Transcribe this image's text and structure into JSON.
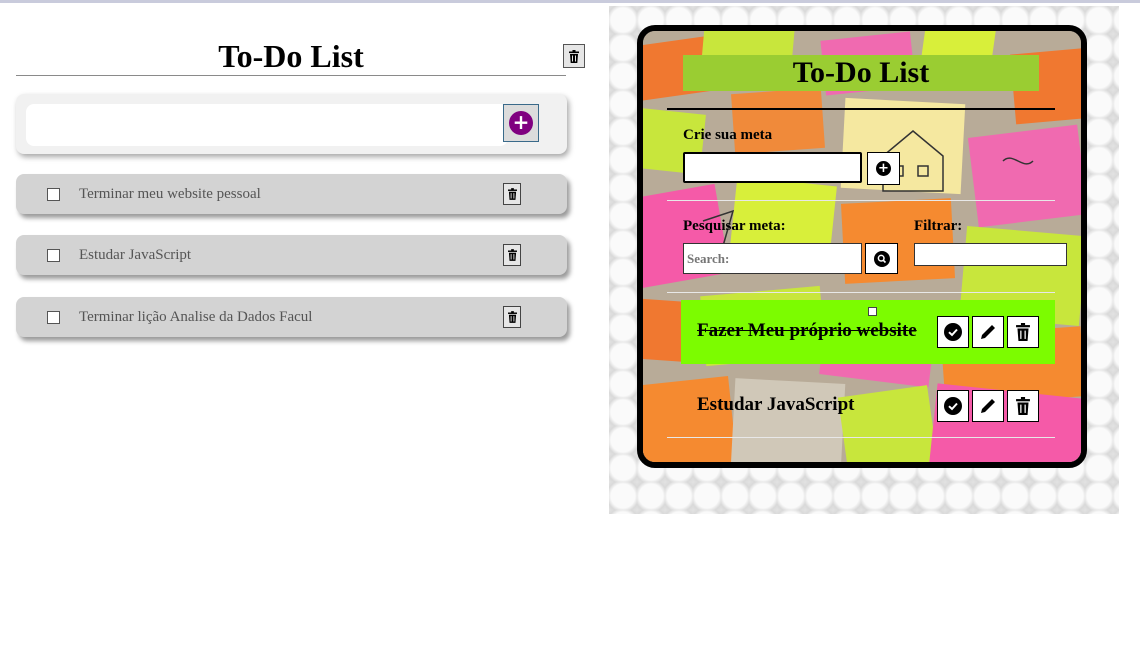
{
  "left_app": {
    "title": "To-Do List",
    "add_input": {
      "value": "",
      "placeholder": ""
    },
    "add_icon": "plus-circle-icon",
    "clear_icon": "trash-icon",
    "items": [
      {
        "text": "Terminar meu website pessoal",
        "checked": false
      },
      {
        "text": "Estudar JavaScript",
        "checked": false
      },
      {
        "text": "Terminar lição Analise da Dados Facul",
        "checked": false
      }
    ]
  },
  "right_app": {
    "title": "To-Do List",
    "title_bg": "#9acd32",
    "create_label": "Crie sua meta",
    "create_input": {
      "value": "",
      "placeholder": ""
    },
    "search_label": "Pesquisar meta:",
    "search_placeholder": "Search:",
    "filter_label": "Filtrar:",
    "filter_value": "",
    "todos": [
      {
        "text": "Fazer Meu próprio website",
        "done": true
      },
      {
        "text": "Estudar JavaScript",
        "done": false
      }
    ],
    "done_color": "#7cfc00",
    "action_icons": [
      "check-circle-icon",
      "pencil-icon",
      "trash-icon"
    ]
  }
}
